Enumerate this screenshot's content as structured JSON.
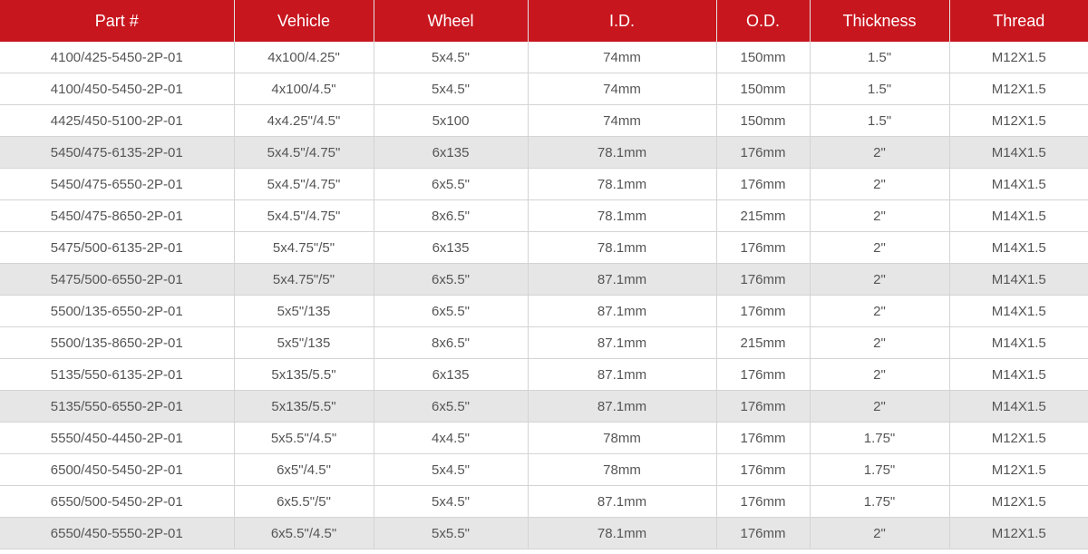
{
  "table": {
    "headers": [
      "Part #",
      "Vehicle",
      "Wheel",
      "I.D.",
      "O.D.",
      "Thickness",
      "Thread"
    ],
    "shaded_rows": [
      3,
      7,
      11,
      15
    ],
    "colors": {
      "header_bg": "#c8161e",
      "header_text": "#ffffff",
      "shaded_row_bg": "#e6e6e6",
      "cell_text": "#555555"
    },
    "rows": [
      [
        "4100/425-5450-2P-01",
        "4x100/4.25\"",
        "5x4.5\"",
        "74mm",
        "150mm",
        "1.5\"",
        "M12X1.5"
      ],
      [
        "4100/450-5450-2P-01",
        "4x100/4.5\"",
        "5x4.5\"",
        "74mm",
        "150mm",
        "1.5\"",
        "M12X1.5"
      ],
      [
        "4425/450-5100-2P-01",
        "4x4.25\"/4.5\"",
        "5x100",
        "74mm",
        "150mm",
        "1.5\"",
        "M12X1.5"
      ],
      [
        "5450/475-6135-2P-01",
        "5x4.5\"/4.75\"",
        "6x135",
        "78.1mm",
        "176mm",
        "2\"",
        "M14X1.5"
      ],
      [
        "5450/475-6550-2P-01",
        "5x4.5\"/4.75\"",
        "6x5.5\"",
        "78.1mm",
        "176mm",
        "2\"",
        "M14X1.5"
      ],
      [
        "5450/475-8650-2P-01",
        "5x4.5\"/4.75\"",
        "8x6.5\"",
        "78.1mm",
        "215mm",
        "2\"",
        "M14X1.5"
      ],
      [
        "5475/500-6135-2P-01",
        "5x4.75\"/5\"",
        "6x135",
        "78.1mm",
        "176mm",
        "2\"",
        "M14X1.5"
      ],
      [
        "5475/500-6550-2P-01",
        "5x4.75\"/5\"",
        "6x5.5\"",
        "87.1mm",
        "176mm",
        "2\"",
        "M14X1.5"
      ],
      [
        "5500/135-6550-2P-01",
        "5x5\"/135",
        "6x5.5\"",
        "87.1mm",
        "176mm",
        "2\"",
        "M14X1.5"
      ],
      [
        "5500/135-8650-2P-01",
        "5x5\"/135",
        "8x6.5\"",
        "87.1mm",
        "215mm",
        "2\"",
        "M14X1.5"
      ],
      [
        "5135/550-6135-2P-01",
        "5x135/5.5\"",
        "6x135",
        "87.1mm",
        "176mm",
        "2\"",
        "M14X1.5"
      ],
      [
        "5135/550-6550-2P-01",
        "5x135/5.5\"",
        "6x5.5\"",
        "87.1mm",
        "176mm",
        "2\"",
        "M14X1.5"
      ],
      [
        "5550/450-4450-2P-01",
        "5x5.5\"/4.5\"",
        "4x4.5\"",
        "78mm",
        "176mm",
        "1.75\"",
        "M12X1.5"
      ],
      [
        "6500/450-5450-2P-01",
        "6x5\"/4.5\"",
        "5x4.5\"",
        "78mm",
        "176mm",
        "1.75\"",
        "M12X1.5"
      ],
      [
        "6550/500-5450-2P-01",
        "6x5.5\"/5\"",
        "5x4.5\"",
        "87.1mm",
        "176mm",
        "1.75\"",
        "M12X1.5"
      ],
      [
        "6550/450-5550-2P-01",
        "6x5.5\"/4.5\"",
        "5x5.5\"",
        "78.1mm",
        "176mm",
        "2\"",
        "M12X1.5"
      ]
    ]
  }
}
